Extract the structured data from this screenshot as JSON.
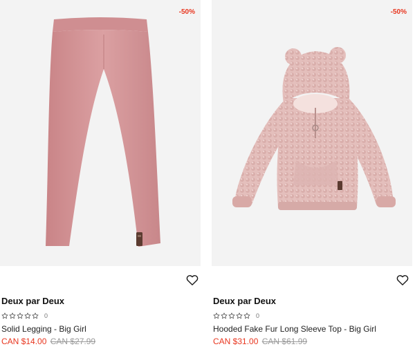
{
  "products": [
    {
      "discount": "-50%",
      "brand": "Deux par Deux",
      "rating_count": "0",
      "name": "Solid Legging - Big Girl",
      "price_current": "CAN $14.00",
      "price_original": "CAN $27.99",
      "image_icon": "legging-product-image"
    },
    {
      "discount": "-50%",
      "brand": "Deux par Deux",
      "rating_count": "0",
      "name": "Hooded Fake Fur Long Sleeve Top - Big Girl",
      "price_current": "CAN $31.00",
      "price_original": "CAN $61.99",
      "image_icon": "hoodie-product-image"
    }
  ],
  "colors": {
    "sale_red": "#e8361f",
    "product_pink": "#d89a9c",
    "fur_pink": "#e6c2bf",
    "image_bg": "#f3f3f3"
  }
}
